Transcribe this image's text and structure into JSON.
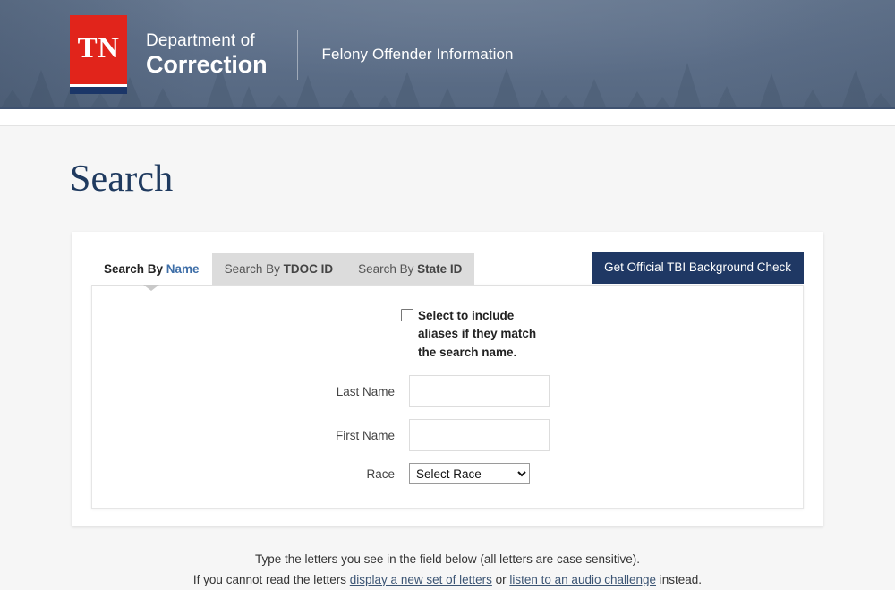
{
  "header": {
    "logo_alt": "TN",
    "dept_line1": "Department of",
    "dept_line2": "Correction",
    "subtitle": "Felony Offender Information"
  },
  "page": {
    "title": "Search"
  },
  "tabs": [
    {
      "prefix": "Search By ",
      "strong": "Name",
      "active": true
    },
    {
      "prefix": "Search By ",
      "strong": "TDOC ID",
      "active": false
    },
    {
      "prefix": "Search By ",
      "strong": "State ID",
      "active": false
    }
  ],
  "actions": {
    "tbi_button": "Get Official TBI Background Check"
  },
  "form": {
    "alias_label_line1": "Select to include aliases if",
    "alias_label_line2": "they match the search name.",
    "alias_checked": false,
    "fields": [
      {
        "label": "Last Name",
        "value": "",
        "placeholder": ""
      },
      {
        "label": "First Name",
        "value": "",
        "placeholder": ""
      }
    ],
    "race_label": "Race",
    "race_selected": "Select Race",
    "race_options": [
      "Select Race"
    ]
  },
  "captcha": {
    "line1": "Type the letters you see in the field below (all letters are case sensitive).",
    "line2_pre": "If you cannot read the letters ",
    "link1": "display a new set of letters",
    "line2_mid": " or ",
    "link2": "listen to an audio challenge",
    "line2_post": " instead."
  },
  "colors": {
    "header_bg": "#5a6c85",
    "logo_red": "#e1241b",
    "logo_navy": "#1b3668",
    "title_navy": "#1f3a5f",
    "button_navy": "#1f3864",
    "tab_active_accent": "#3f6fa8",
    "link": "#3c5574",
    "page_bg": "#f6f6f6"
  }
}
